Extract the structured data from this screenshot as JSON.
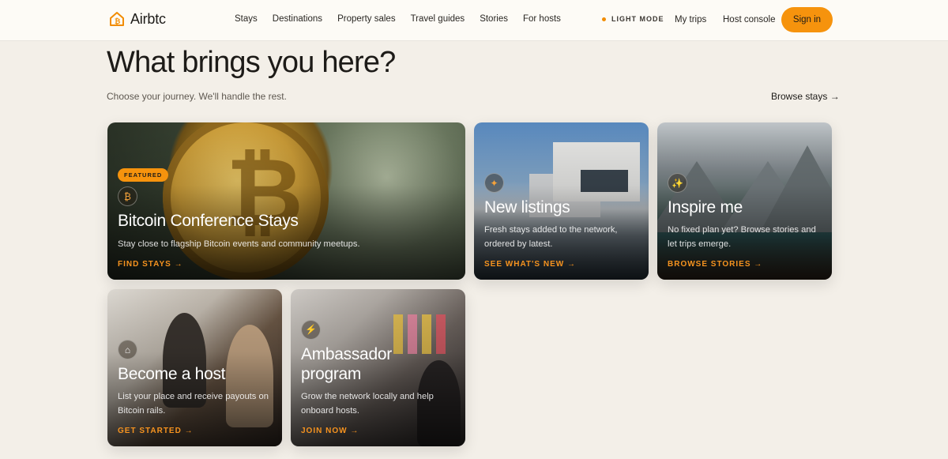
{
  "header": {
    "logo_text": "Airbtc",
    "nav": [
      "Stays",
      "Destinations",
      "Property sales",
      "Travel guides",
      "Stories",
      "For hosts"
    ],
    "mode_label": "LIGHT MODE",
    "my_trips": "My trips",
    "host_console": "Host console",
    "sign_in": "Sign in"
  },
  "hero": {
    "title": "What brings you here?",
    "subtitle": "Choose your journey. We'll handle the rest.",
    "browse_link": "Browse stays →"
  },
  "cards": {
    "bitcoin": {
      "badge": "FEATURED",
      "icon": "bitcoin-icon",
      "icon_glyph": "₿",
      "title": "Bitcoin Conference Stays",
      "desc": "Stay close to flagship Bitcoin events and community meetups.",
      "cta": "FIND STAYS →"
    },
    "new_listings": {
      "icon": "sparkle-icon",
      "icon_glyph": "✦",
      "title": "New listings",
      "desc": "Fresh stays added to the network, ordered by latest.",
      "cta": "SEE WHAT'S NEW →"
    },
    "inspire": {
      "icon": "stars-icon",
      "icon_glyph": "✨",
      "title": "Inspire me",
      "desc": "No fixed plan yet? Browse stories and let trips emerge.",
      "cta": "BROWSE STORIES →"
    },
    "host": {
      "icon": "house-icon",
      "icon_glyph": "⌂",
      "title": "Become a host",
      "desc": "List your place and receive payouts on Bitcoin rails.",
      "cta": "GET STARTED →"
    },
    "ambassador": {
      "icon": "lightning-icon",
      "icon_glyph": "⚡",
      "title": "Ambassador program",
      "desc": "Grow the network locally and help onboard hosts.",
      "cta": "JOIN NOW →"
    }
  },
  "colors": {
    "accent": "#f6930d",
    "background": "#f3efe8",
    "header_bg": "#fdfbf6"
  }
}
